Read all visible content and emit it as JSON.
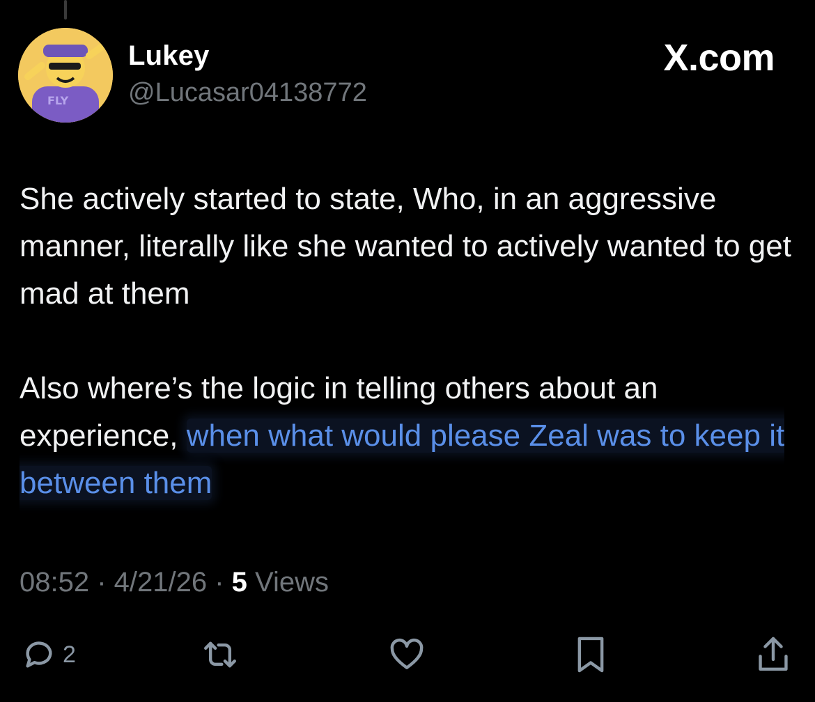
{
  "author": {
    "display_name": "Lukey",
    "handle": "@Lucasar04138772",
    "avatar_icon": "cartoon-avatar-icon",
    "avatar_shirt_text": "FLY"
  },
  "brand": {
    "label": "X.com"
  },
  "tweet": {
    "paragraph_1": "She actively started to state, Who, in an aggressive manner, literally like she wanted to actively wanted to get mad at them",
    "paragraph_2_plain": "Also where’s the logic in telling others about an experience, ",
    "paragraph_2_highlight": "when what would please Zeal was to keep it between them"
  },
  "meta": {
    "time": "08:52",
    "separator": " · ",
    "date": "4/21/26",
    "views_count": "5",
    "views_label": " Views"
  },
  "actions": {
    "reply_icon": "reply-icon",
    "reply_count": "2",
    "repost_icon": "repost-icon",
    "like_icon": "heart-icon",
    "bookmark_icon": "bookmark-icon",
    "share_icon": "share-icon"
  },
  "colors": {
    "background": "#000000",
    "primary_text": "#e7e9ea",
    "secondary_text": "#71767b",
    "highlight_text": "#5a8fe8"
  }
}
